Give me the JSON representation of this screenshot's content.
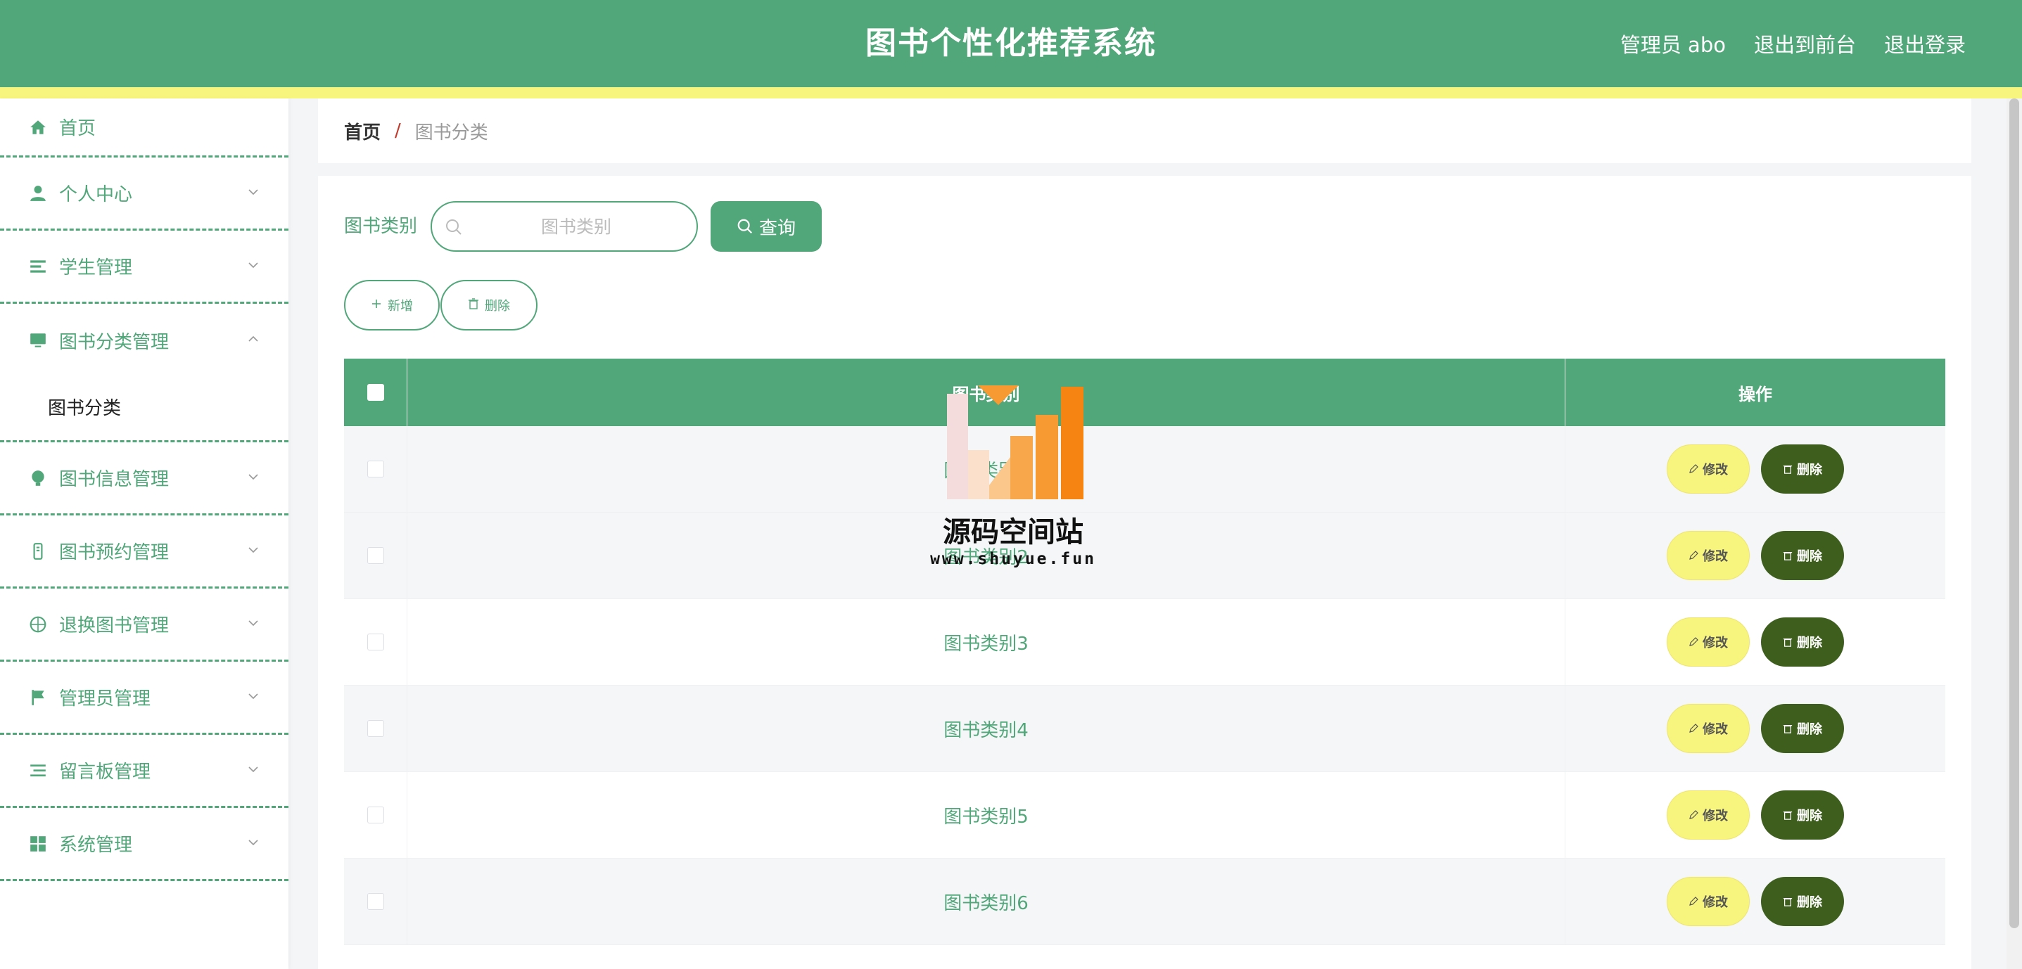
{
  "header": {
    "title": "图书个性化推荐系统",
    "user_label": "管理员 abo",
    "front_link": "退出到前台",
    "logout_link": "退出登录"
  },
  "sidebar": {
    "items": [
      {
        "label": "首页",
        "icon": "home-icon"
      },
      {
        "label": "个人中心",
        "icon": "person-icon"
      },
      {
        "label": "学生管理",
        "icon": "list-icon"
      },
      {
        "label": "图书分类管理",
        "icon": "monitor-icon",
        "expanded": true,
        "children": [
          "图书分类"
        ]
      },
      {
        "label": "图书信息管理",
        "icon": "bulb-icon"
      },
      {
        "label": "图书预约管理",
        "icon": "phone-icon"
      },
      {
        "label": "退换图书管理",
        "icon": "compass-icon"
      },
      {
        "label": "管理员管理",
        "icon": "flag-icon"
      },
      {
        "label": "留言板管理",
        "icon": "menu-list-icon"
      },
      {
        "label": "系统管理",
        "icon": "grid-icon"
      }
    ]
  },
  "breadcrumb": {
    "home": "首页",
    "separator": "/",
    "current": "图书分类"
  },
  "search": {
    "label": "图书类别",
    "placeholder": "图书类别",
    "button": "查询"
  },
  "actions": {
    "add": "新增",
    "delete": "删除"
  },
  "table": {
    "columns": [
      "图书类别",
      "操作"
    ],
    "rows": [
      {
        "name": "图书类别1"
      },
      {
        "name": "图书类别2"
      },
      {
        "name": "图书类别3"
      },
      {
        "name": "图书类别4"
      },
      {
        "name": "图书类别5"
      },
      {
        "name": "图书类别6"
      }
    ],
    "edit_label": "修改",
    "remove_label": "删除"
  },
  "watermark": {
    "text": "源码空间站",
    "url": "www.shuyue.fun"
  },
  "colors": {
    "primary": "#51a77a",
    "accent_yellow": "#f8f57e",
    "danger_dark": "#3e5e1d"
  }
}
